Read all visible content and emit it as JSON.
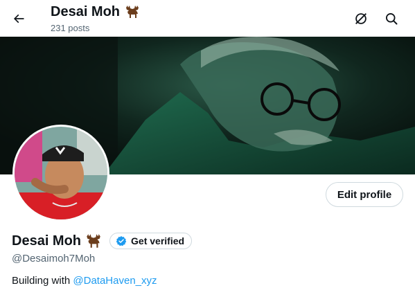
{
  "header": {
    "back_icon": "arrow-left-icon",
    "title": "Desai Moh",
    "title_emoji": "moose-icon",
    "posts_count": "231 posts",
    "actions": [
      {
        "icon": "no-sign-icon"
      },
      {
        "icon": "search-icon"
      }
    ]
  },
  "profile": {
    "edit_button_label": "Edit profile",
    "name": "Desai Moh",
    "name_emoji": "moose-icon",
    "verify_label": "Get verified",
    "handle": "@Desaimoh7Moh",
    "bio_text": "Building with ",
    "bio_link": "@DataHaven_xyz"
  },
  "colors": {
    "accent": "#1d9bf0",
    "text_primary": "#0f1419",
    "text_secondary": "#536471",
    "border": "#cfd9de"
  }
}
